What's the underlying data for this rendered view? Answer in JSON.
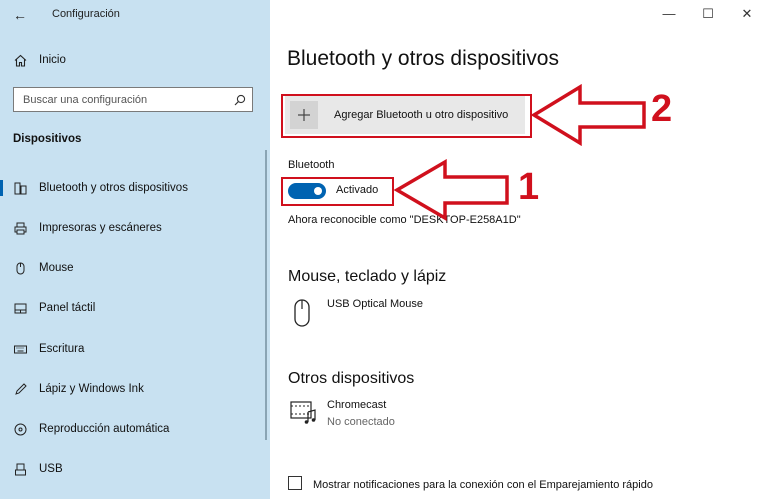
{
  "window": {
    "title": "Configuración",
    "back_icon": "arrow-left-icon",
    "controls": {
      "minimize": "—",
      "maximize": "☐",
      "close": "✕"
    }
  },
  "sidebar": {
    "home_label": "Inicio",
    "search_placeholder": "Buscar una configuración",
    "section_title": "Dispositivos",
    "items": [
      {
        "label": "Bluetooth y otros dispositivos",
        "icon": "bluetooth-devices-icon",
        "active": true
      },
      {
        "label": "Impresoras y escáneres",
        "icon": "printer-icon"
      },
      {
        "label": "Mouse",
        "icon": "mouse-icon"
      },
      {
        "label": "Panel táctil",
        "icon": "touchpad-icon"
      },
      {
        "label": "Escritura",
        "icon": "keyboard-icon"
      },
      {
        "label": "Lápiz y Windows Ink",
        "icon": "pen-icon"
      },
      {
        "label": "Reproducción automática",
        "icon": "autoplay-icon"
      },
      {
        "label": "USB",
        "icon": "usb-icon"
      }
    ]
  },
  "main": {
    "title": "Bluetooth y otros dispositivos",
    "add_device_label": "Agregar Bluetooth u otro dispositivo",
    "bluetooth_section": "Bluetooth",
    "toggle_state": "Activado",
    "discoverable_text": "Ahora reconocible como \"DESKTOP-E258A1D\"",
    "mouse_section": "Mouse, teclado y lápiz",
    "mouse_device": "USB Optical Mouse",
    "other_section": "Otros dispositivos",
    "other_device": "Chromecast",
    "other_device_status": "No conectado",
    "checkbox_label": "Mostrar notificaciones para la conexión con el Emparejamiento rápido"
  },
  "annotations": {
    "number_1": "1",
    "number_2": "2",
    "color": "#d0101d"
  },
  "colors": {
    "sidebar_bg": "#c8e1f1",
    "accent": "#0063b1"
  }
}
